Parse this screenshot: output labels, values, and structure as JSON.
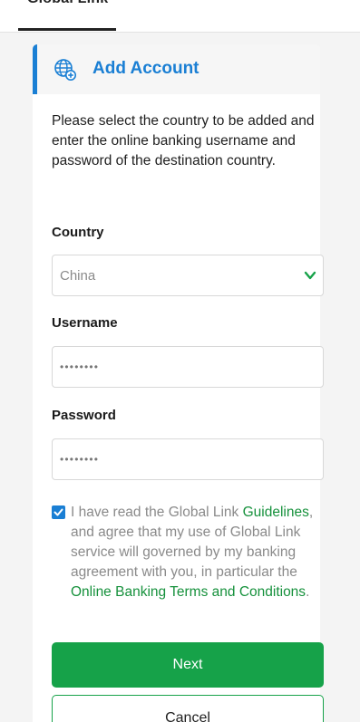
{
  "top_tab": {
    "label": "Global Link"
  },
  "card": {
    "title": "Add Account",
    "title_icon": "globe-plus-icon",
    "intro": "Please select the country to be added and enter the online banking username and password of the destination country."
  },
  "form": {
    "country_label": "Country",
    "country_value": "China",
    "username_label": "Username",
    "username_value": "••••••••",
    "password_label": "Password",
    "password_value": "••••••••"
  },
  "agreement": {
    "checked": true,
    "text_1": "I have read the Global Link ",
    "link_1": "Guidelines",
    "text_2": ", and agree that my use of Global Link service will governed by my banking agreement with you, in particular the ",
    "link_2": "Online Banking Terms and Conditions",
    "text_3": "."
  },
  "buttons": {
    "next": "Next",
    "cancel": "Cancel"
  },
  "colors": {
    "accent_blue": "#1a7fd4",
    "accent_green": "#16a249",
    "link_green": "#16913c"
  }
}
